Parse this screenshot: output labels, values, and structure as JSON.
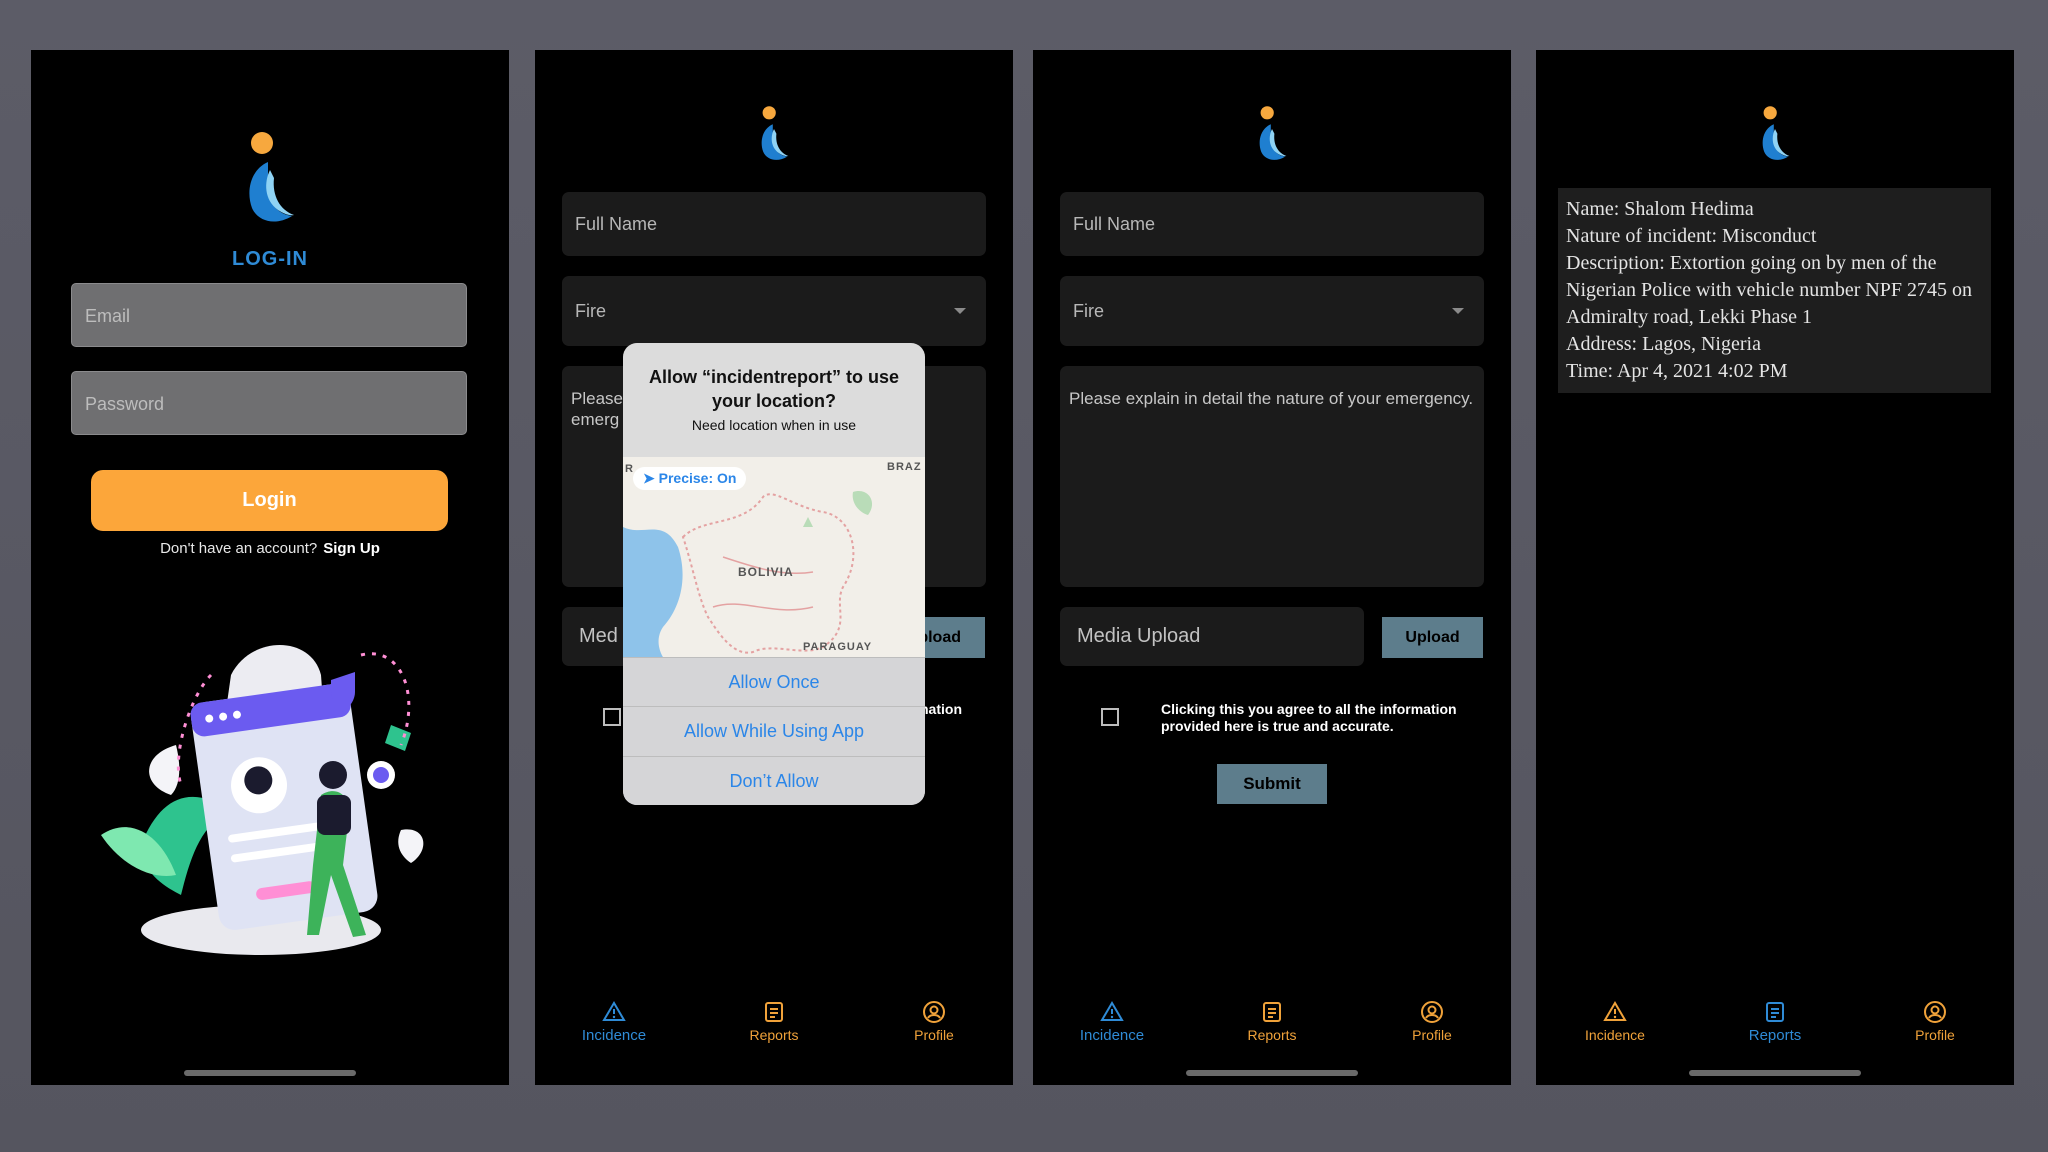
{
  "login": {
    "title": "LOG-IN",
    "email_placeholder": "Email",
    "password_placeholder": "Password",
    "login_label": "Login",
    "signup_prompt": "Don't have an account?",
    "signup_link": "Sign Up"
  },
  "form": {
    "full_name_placeholder": "Full Name",
    "incident_type": "Fire",
    "description_placeholder": "Please explain in detail the nature of your emergency.",
    "media_placeholder": "Media Upload",
    "upload_label": "Upload",
    "agree_text": "Clicking this you agree to all the information provided here is true and accurate.",
    "submit_label": "Submit"
  },
  "partial": {
    "desc_fragment_1": "Please",
    "desc_fragment_2": "emerg",
    "media_fragment": "Med",
    "upload_fragment": "pload",
    "agree_fragment": "nation"
  },
  "alert": {
    "title": "Allow “incidentreport” to use your location?",
    "message": "Need location when in use",
    "precise": "Precise: On",
    "map_labels": {
      "bolivia": "BOLIVIA",
      "paraguay": "PARAGUAY",
      "brazil": "BRAZ",
      "peru": "R"
    },
    "allow_once": "Allow Once",
    "allow_while": "Allow While Using App",
    "dont_allow": "Don’t Allow"
  },
  "tabs": {
    "incidence": "Incidence",
    "reports": "Reports",
    "profile": "Profile"
  },
  "report": {
    "name": "Name: Shalom Hedima",
    "nature": "Nature of incident: Misconduct",
    "description": "Description: Extortion going on by men of the Nigerian Police with vehicle number NPF 2745 on Admiralty road, Lekki Phase 1",
    "address": "Address: Lagos, Nigeria",
    "time": "Time: Apr 4, 2021 4:02 PM"
  },
  "colors": {
    "accent_blue": "#2f8bd6",
    "accent_orange": "#fca63a",
    "button_steel": "#5d7d8c"
  }
}
